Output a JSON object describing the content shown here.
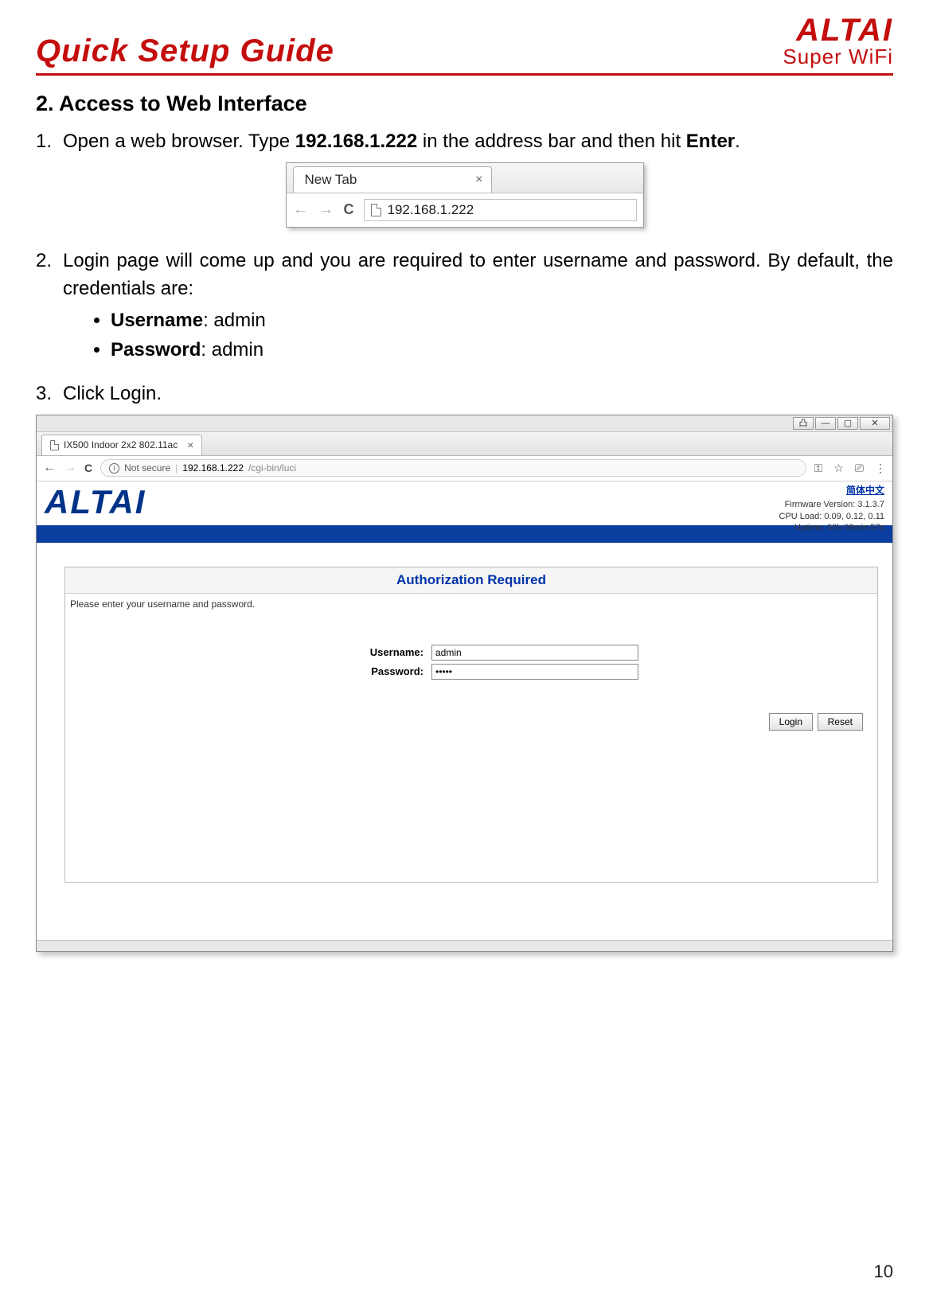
{
  "header": {
    "title": "Quick Setup Guide",
    "logo_main": "ALTAI",
    "logo_sub": "Super WiFi"
  },
  "section": {
    "number": "2.",
    "title": "Access to Web Interface"
  },
  "steps": {
    "s1": {
      "num": "1.",
      "pre": "Open a web browser. Type ",
      "ip": "192.168.1.222",
      "mid": " in the address bar and then hit ",
      "key": "Enter",
      "post": "."
    },
    "s2": {
      "num": "2.",
      "text": "Login page will come up and you are required to enter username and password. By default, the credentials are:",
      "user_label": "Username",
      "user_val": ": admin",
      "pass_label": "Password",
      "pass_val": ": admin"
    },
    "s3": {
      "num": "3.",
      "text": "Click Login."
    }
  },
  "shot1": {
    "tab_title": "New Tab",
    "address": "192.168.1.222"
  },
  "shot2": {
    "tab_title": "IX500 Indoor 2x2 802.11ac",
    "not_secure": "Not secure",
    "url_dark": "192.168.1.222",
    "url_grey": "/cgi-bin/luci",
    "lang_link": "简体中文",
    "fw_line": "Firmware Version: 3.1.3.7",
    "cpu_line": "CPU Load: 0.09, 0.12, 0.11",
    "up_line": "Uptime: 00h 09min 57s",
    "logo": "ALTAI",
    "auth_title": "Authorization Required",
    "auth_hint": "Please enter your username and password.",
    "user_label": "Username:",
    "user_value": "admin",
    "pass_label": "Password:",
    "pass_value": "•••••",
    "login_btn": "Login",
    "reset_btn": "Reset"
  },
  "page_number": "10"
}
